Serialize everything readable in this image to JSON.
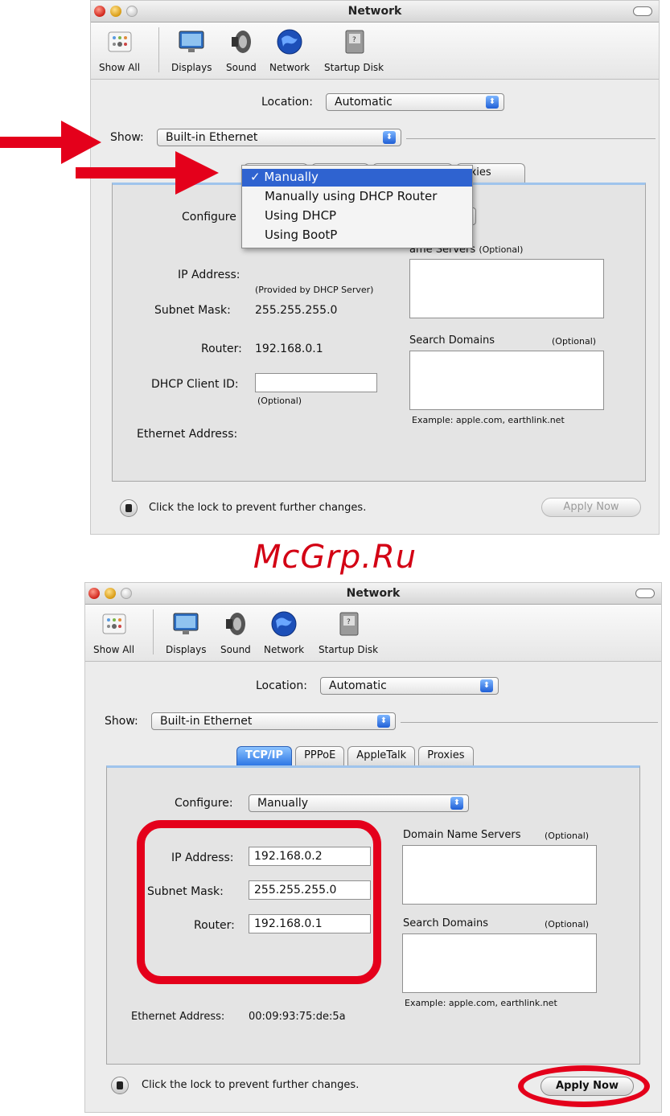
{
  "window_title": "Network",
  "toolbar": {
    "show_all": "Show All",
    "displays": "Displays",
    "sound": "Sound",
    "network": "Network",
    "startup_disk": "Startup Disk"
  },
  "location": {
    "label": "Location:",
    "value": "Automatic"
  },
  "show": {
    "label": "Show:",
    "value": "Built-in Ethernet"
  },
  "tabs": [
    "TCP/IP",
    "PPPoE",
    "AppleTalk",
    "Proxies"
  ],
  "tab_fragment_visible": "roxies",
  "menu": {
    "check_mark": "✓",
    "items": [
      "Manually",
      "Manually using DHCP Router",
      "Using DHCP",
      "Using BootP"
    ]
  },
  "screen1": {
    "configure_label": "Configure",
    "ip_label": "IP Address:",
    "ip_note": "(Provided by DHCP Server)",
    "subnet_label": "Subnet Mask:",
    "subnet_value": "255.255.255.0",
    "router_label": "Router:",
    "router_value": "192.168.0.1",
    "dhcp_label": "DHCP Client ID:",
    "dhcp_value": "",
    "dhcp_note": "(Optional)",
    "ethernet_label": "Ethernet Address:",
    "dns_fragment": "ame Servers",
    "dns_optional": "(Optional)",
    "search_label": "Search Domains",
    "search_optional": "(Optional)",
    "example": "Example: apple.com, earthlink.net"
  },
  "screen2": {
    "configure_label": "Configure:",
    "configure_value": "Manually",
    "ip_label": "IP Address:",
    "ip_value": "192.168.0.2",
    "subnet_label": "Subnet Mask:",
    "subnet_value": "255.255.255.0",
    "router_label": "Router:",
    "router_value": "192.168.0.1",
    "dns_label": "Domain Name Servers",
    "dns_optional": "(Optional)",
    "search_label": "Search Domains",
    "search_optional": "(Optional)",
    "example": "Example: apple.com, earthlink.net",
    "ethernet_label": "Ethernet Address:",
    "ethernet_value": "00:09:93:75:de:5a"
  },
  "lock_text": "Click the lock to prevent further changes.",
  "apply_now": "Apply Now",
  "watermark": "McGrp.Ru",
  "colors": {
    "highlight": "#e4001b",
    "selection": "#2f63d0"
  }
}
